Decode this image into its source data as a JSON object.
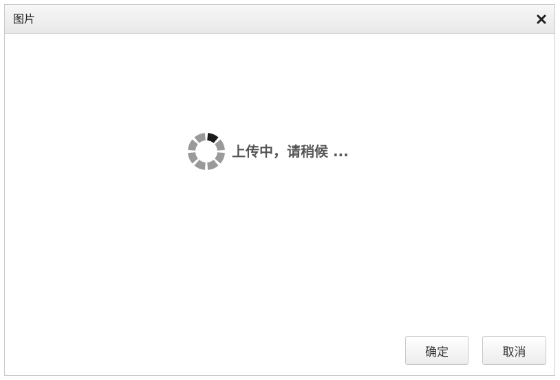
{
  "dialog": {
    "title": "图片",
    "close_icon": "close-icon"
  },
  "loading": {
    "icon": "loading-spinner-icon",
    "text": "上传中，请稍候 ..."
  },
  "buttons": {
    "ok_label": "确定",
    "cancel_label": "取消"
  },
  "colors": {
    "spinner_active": "#1a1a1a",
    "spinner_inactive": "#9a9a9a",
    "text": "#555555"
  }
}
